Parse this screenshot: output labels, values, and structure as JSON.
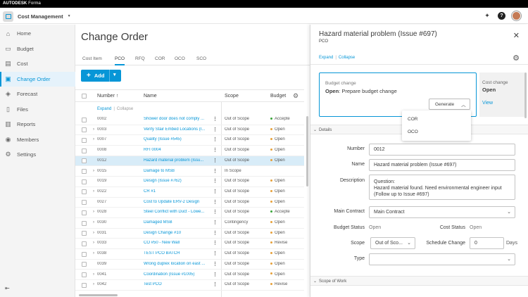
{
  "brand": {
    "bold": "AUTODESK",
    "light": "Forma"
  },
  "module": {
    "name": "Cost Management"
  },
  "sidebar": {
    "items": [
      {
        "label": "Home",
        "icon": "home-icon",
        "glyph": "⌂"
      },
      {
        "label": "Budget",
        "icon": "budget-icon",
        "glyph": "▭"
      },
      {
        "label": "Cost",
        "icon": "cost-icon",
        "glyph": "▤"
      },
      {
        "label": "Change Order",
        "icon": "change-order-icon",
        "glyph": "▣"
      },
      {
        "label": "Forecast",
        "icon": "forecast-icon",
        "glyph": "◈"
      },
      {
        "label": "Files",
        "icon": "files-icon",
        "glyph": "▯"
      },
      {
        "label": "Reports",
        "icon": "reports-icon",
        "glyph": "▥"
      },
      {
        "label": "Members",
        "icon": "members-icon",
        "glyph": "◉"
      },
      {
        "label": "Settings",
        "icon": "settings-icon",
        "glyph": "⚙"
      }
    ],
    "active_index": 3
  },
  "main": {
    "title": "Change Order",
    "tabs": [
      "Cost Item",
      "PCO",
      "RFQ",
      "COR",
      "OCO",
      "SCO"
    ],
    "active_tab": "PCO",
    "add_label": "Add",
    "columns": {
      "number": "Number",
      "name": "Name",
      "scope": "Scope",
      "budget": "Budget"
    },
    "expand": "Expand",
    "collapse": "Collapse",
    "rows": [
      {
        "number": "0002",
        "name": "Shower door does not comply ...",
        "scope": "Out of Scope",
        "budget": "Accepte",
        "dot": "#3aa53a",
        "chev": false
      },
      {
        "number": "0003",
        "name": "Verify Stair Embed Locations (I...",
        "scope": "Out of Scope",
        "budget": "Open",
        "dot": "#e7a13a",
        "chev": true
      },
      {
        "number": "0007",
        "name": "Quality (Issue #545)",
        "scope": "Out of Scope",
        "budget": "Open",
        "dot": "#e7a13a",
        "chev": true
      },
      {
        "number": "0008",
        "name": "RFI 0004",
        "scope": "Out of Scope",
        "budget": "Open",
        "dot": "#e7a13a",
        "chev": false
      },
      {
        "number": "0012",
        "name": "Hazard material problem (Issu...",
        "scope": "Out of Scope",
        "budget": "Open",
        "dot": "#e7a13a",
        "chev": false
      },
      {
        "number": "0015",
        "name": "Damage to MSB",
        "scope": "In Scope",
        "budget": "",
        "dot": "",
        "chev": true
      },
      {
        "number": "0019",
        "name": "Design (Issue #762)",
        "scope": "Out of Scope",
        "budget": "Open",
        "dot": "#e7a13a",
        "chev": false
      },
      {
        "number": "0022",
        "name": "CR #1",
        "scope": "Out of Scope",
        "budget": "Open",
        "dot": "#e7a13a",
        "chev": true
      },
      {
        "number": "0027",
        "name": "Cost to Update ERV-2 Design",
        "scope": "Out of Scope",
        "budget": "Open",
        "dot": "#e7a13a",
        "chev": false
      },
      {
        "number": "0028",
        "name": "Steel Conflict with Duct - Lowe...",
        "scope": "Out of Scope",
        "budget": "Accepte",
        "dot": "#3aa53a",
        "chev": true
      },
      {
        "number": "0030",
        "name": "Damaged MSB",
        "scope": "Contingency",
        "budget": "Open",
        "dot": "#e7a13a",
        "chev": true
      },
      {
        "number": "0031",
        "name": "Design Change #10",
        "scope": "Out of Scope",
        "budget": "Open",
        "dot": "#e7a13a",
        "chev": true
      },
      {
        "number": "0033",
        "name": "CO #50 - New Wall",
        "scope": "Out of Scope",
        "budget": "Revise",
        "dot": "#e7a13a",
        "chev": true
      },
      {
        "number": "0038",
        "name": "TEST PCO BATCH",
        "scope": "Out of Scope",
        "budget": "Open",
        "dot": "#e7a13a",
        "chev": true
      },
      {
        "number": "0039",
        "name": "Wrong duplex location on east ...",
        "scope": "Out of Scope",
        "budget": "Open",
        "dot": "#e7a13a",
        "chev": false
      },
      {
        "number": "0041",
        "name": "Coordination (Issue #1005)",
        "scope": "Out of Scope",
        "budget": "Open",
        "dot": "#e7a13a",
        "chev": true
      },
      {
        "number": "0042",
        "name": "Test PCO",
        "scope": "Out of Scope",
        "budget": "Revise",
        "dot": "#e7a13a",
        "chev": true
      }
    ],
    "selected_row": 4
  },
  "panel": {
    "title": "Hazard material problem (Issue #697)",
    "subtitle": "PCO",
    "expand": "Expand",
    "collapse": "Collapse",
    "budget_change": {
      "label": "Budget change",
      "status": "Open",
      "detail": ": Prepare budget change"
    },
    "cost_change": {
      "label": "Cost change",
      "status": "Open",
      "view": "View"
    },
    "generate": {
      "label": "Generate",
      "options": [
        "COR",
        "OCO"
      ]
    },
    "details_section": "Details",
    "fields": {
      "number_label": "Number",
      "number": "0012",
      "name_label": "Name",
      "name": "Hazard material problem (Issue #697)",
      "description_label": "Description",
      "description": "Question:\nHazard material found. Need environmental engineer input (Follow up to Issue #697)",
      "main_contract_label": "Main Contract",
      "main_contract": "Main Contract",
      "budget_status_label": "Budget Status",
      "budget_status": "Open",
      "cost_status_label": "Cost Status",
      "cost_status": "Open",
      "scope_label": "Scope",
      "scope": "Out of Sco...",
      "schedule_label": "Schedule Change",
      "schedule": "0",
      "schedule_unit": "Days",
      "type_label": "Type",
      "type": ""
    },
    "scope_section": "Scope of Work"
  },
  "colors": {
    "accent": "#0696d7",
    "selected_row": "#d8ecf8",
    "open": "#e7a13a",
    "accepted": "#3aa53a"
  }
}
